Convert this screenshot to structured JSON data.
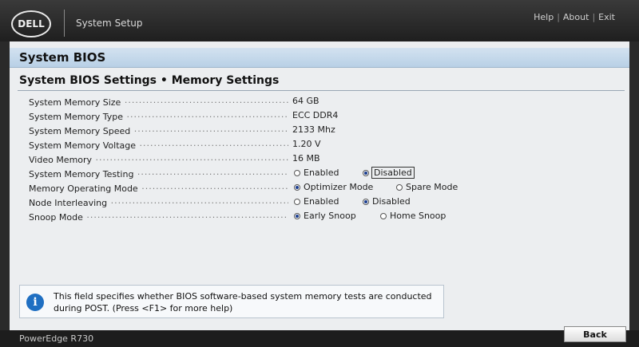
{
  "header": {
    "logo_text": "DELL",
    "app_title": "System Setup",
    "links": [
      "Help",
      "About",
      "Exit"
    ],
    "separator": "|"
  },
  "section": {
    "title": "System BIOS",
    "subtitle": "System BIOS Settings • Memory Settings"
  },
  "settings": {
    "memory_size": {
      "label": "System Memory Size",
      "value": "64 GB"
    },
    "memory_type": {
      "label": "System Memory Type",
      "value": "ECC DDR4"
    },
    "memory_speed": {
      "label": "System Memory Speed",
      "value": "2133 Mhz"
    },
    "memory_voltage": {
      "label": "System Memory Voltage",
      "value": "1.20 V"
    },
    "video_memory": {
      "label": "Video Memory",
      "value": "16 MB"
    },
    "memory_testing": {
      "label": "System Memory Testing",
      "options": [
        "Enabled",
        "Disabled"
      ],
      "selected": "Disabled"
    },
    "operating_mode": {
      "label": "Memory Operating Mode",
      "options": [
        "Optimizer Mode",
        "Spare Mode"
      ],
      "selected": "Optimizer Mode"
    },
    "node_interleaving": {
      "label": "Node Interleaving",
      "options": [
        "Enabled",
        "Disabled"
      ],
      "selected": "Disabled"
    },
    "snoop_mode": {
      "label": "Snoop Mode",
      "options": [
        "Early Snoop",
        "Home Snoop"
      ],
      "selected": "Early Snoop"
    }
  },
  "help": {
    "icon": "info-icon",
    "text": "This field specifies whether BIOS software-based system memory tests are conducted during POST. (Press <F1> for more help)"
  },
  "footer": {
    "model": "PowerEdge R730",
    "back_label": "Back"
  },
  "colors": {
    "panel": "#eceef0",
    "header_band": "#b8d0e6",
    "radio_selected": "#1a3d8f",
    "info_icon": "#1f6fc2"
  }
}
